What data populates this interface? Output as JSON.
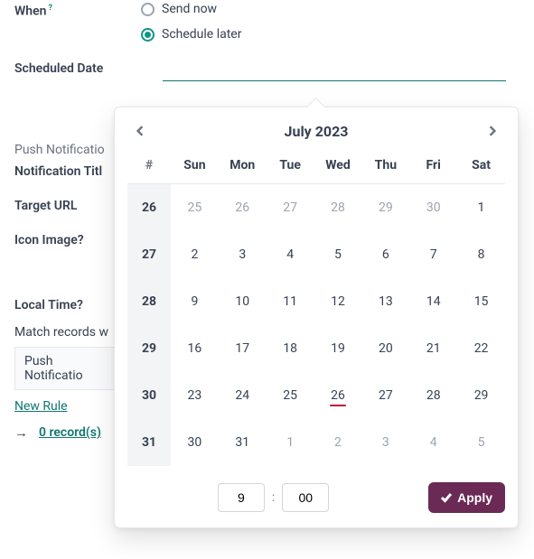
{
  "form": {
    "when_label": "When",
    "when_help": "?",
    "send_now_label": "Send now",
    "schedule_later_label": "Schedule later",
    "scheduled_date_label": "Scheduled Date",
    "scheduled_date_value": "",
    "push_section_heading": "Push Notificatio",
    "notification_title_label": "Notification Titl",
    "target_url_label": "Target URL",
    "icon_image_label": "Icon Image",
    "icon_image_help": "?",
    "local_time_label": "Local Time",
    "local_time_help": "?",
    "match_records_label": "Match records w",
    "match_select_value": "Push Notificatio",
    "new_rule_label": "New Rule",
    "records_count_text": "0 record(s)"
  },
  "calendar": {
    "title": "July 2023",
    "weekno_header": "#",
    "headers": [
      "Sun",
      "Mon",
      "Tue",
      "Wed",
      "Thu",
      "Fri",
      "Sat"
    ],
    "rows": [
      {
        "week": "26",
        "days": [
          {
            "d": "25",
            "out": true
          },
          {
            "d": "26",
            "out": true
          },
          {
            "d": "27",
            "out": true
          },
          {
            "d": "28",
            "out": true
          },
          {
            "d": "29",
            "out": true
          },
          {
            "d": "30",
            "out": true
          },
          {
            "d": "1"
          }
        ]
      },
      {
        "week": "27",
        "days": [
          {
            "d": "2"
          },
          {
            "d": "3"
          },
          {
            "d": "4"
          },
          {
            "d": "5"
          },
          {
            "d": "6"
          },
          {
            "d": "7"
          },
          {
            "d": "8"
          }
        ]
      },
      {
        "week": "28",
        "days": [
          {
            "d": "9"
          },
          {
            "d": "10"
          },
          {
            "d": "11"
          },
          {
            "d": "12"
          },
          {
            "d": "13"
          },
          {
            "d": "14"
          },
          {
            "d": "15"
          }
        ]
      },
      {
        "week": "29",
        "days": [
          {
            "d": "16"
          },
          {
            "d": "17"
          },
          {
            "d": "18"
          },
          {
            "d": "19"
          },
          {
            "d": "20"
          },
          {
            "d": "21"
          },
          {
            "d": "22"
          }
        ]
      },
      {
        "week": "30",
        "days": [
          {
            "d": "23"
          },
          {
            "d": "24"
          },
          {
            "d": "25"
          },
          {
            "d": "26",
            "today": true
          },
          {
            "d": "27"
          },
          {
            "d": "28"
          },
          {
            "d": "29"
          }
        ]
      },
      {
        "week": "31",
        "days": [
          {
            "d": "30"
          },
          {
            "d": "31"
          },
          {
            "d": "1",
            "out": true
          },
          {
            "d": "2",
            "out": true
          },
          {
            "d": "3",
            "out": true
          },
          {
            "d": "4",
            "out": true
          },
          {
            "d": "5",
            "out": true
          }
        ]
      }
    ],
    "time_hour": "9",
    "time_minute": "00",
    "apply_label": "Apply"
  },
  "colors": {
    "accent_teal": "#0f766e",
    "apply_purple": "#6b2a56",
    "today_underline": "#be123c"
  }
}
